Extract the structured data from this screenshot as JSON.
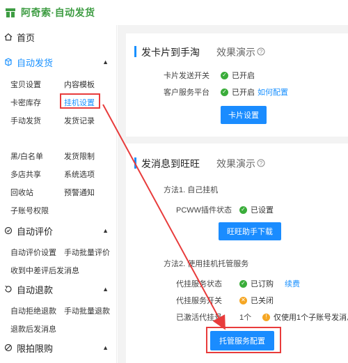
{
  "app": {
    "title": "阿奇索·自动发货"
  },
  "sidebar": {
    "home": "首页",
    "sections": [
      {
        "label": "自动发货",
        "items": [
          "宝贝设置",
          "内容模板",
          "卡密库存",
          "挂机设置",
          "手动发货",
          "发货记录",
          "黑/白名单",
          "发货限制",
          "多店共享",
          "系统选项",
          "回收站",
          "预警通知",
          "子账号权限"
        ]
      },
      {
        "label": "自动评价",
        "items": [
          "自动评价设置",
          "手动批量评价",
          "收到中差评后发消息"
        ]
      },
      {
        "label": "自动退款",
        "items": [
          "自动拒绝退款",
          "手动批量退款",
          "退款后发消息"
        ]
      },
      {
        "label": "限拍限购",
        "items": []
      }
    ]
  },
  "card1": {
    "title": "发卡片到手淘",
    "demo": "效果演示",
    "rows": [
      {
        "label": "卡片发送开关",
        "value": "已开启"
      },
      {
        "label": "客户服务平台",
        "value": "已开启",
        "link": "如何配置"
      }
    ],
    "button": "卡片设置"
  },
  "card2": {
    "title": "发消息到旺旺",
    "demo": "效果演示",
    "method1": "方法1. 自己挂机",
    "pcww_label": "PCWW插件状态",
    "pcww_value": "已设置",
    "download_button": "旺旺助手下载",
    "method2": "方法2. 使用挂机托管服务",
    "rows": [
      {
        "label": "代挂服务状态",
        "value": "已订购",
        "link": "续费"
      },
      {
        "label": "代挂服务开关",
        "value": "已关闭"
      },
      {
        "label": "已激活代挂号",
        "value": "1个",
        "note": "仅使用1个子账号发消息"
      }
    ],
    "config_button": "托管服务配置"
  },
  "colors": {
    "brand": "#3d9c42",
    "accent": "#1890ff",
    "highlight": "#e83b3b",
    "ok": "#3aad3a",
    "warn": "#f5a623"
  }
}
